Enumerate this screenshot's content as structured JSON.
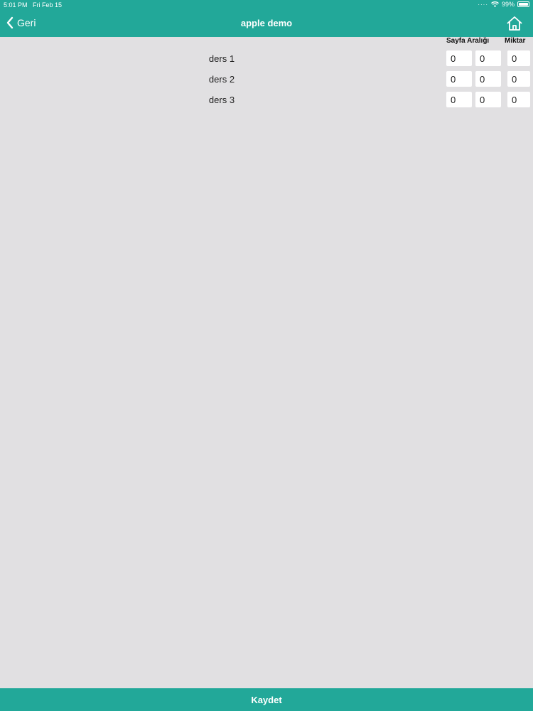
{
  "status_bar": {
    "time": "5:01 PM",
    "date": "Fri Feb 15",
    "battery": "99%",
    "icons": [
      "signal-dots-icon",
      "wifi-icon",
      "battery-icon"
    ]
  },
  "nav": {
    "back_label": "Geri",
    "title": "apple demo",
    "home_icon": "home-icon"
  },
  "table": {
    "headers": [
      "Sayfa Aralığı",
      "Miktar"
    ],
    "rows": [
      {
        "label": "ders 1",
        "start": "0",
        "end": "0",
        "amount": "0"
      },
      {
        "label": "ders 2",
        "start": "0",
        "end": "0",
        "amount": "0"
      },
      {
        "label": "ders 3",
        "start": "0",
        "end": "0",
        "amount": "0"
      }
    ]
  },
  "footer": {
    "save_label": "Kaydet"
  },
  "colors": {
    "accent": "#22a899",
    "background": "#e1e0e2",
    "input_bg": "#ffffff"
  }
}
